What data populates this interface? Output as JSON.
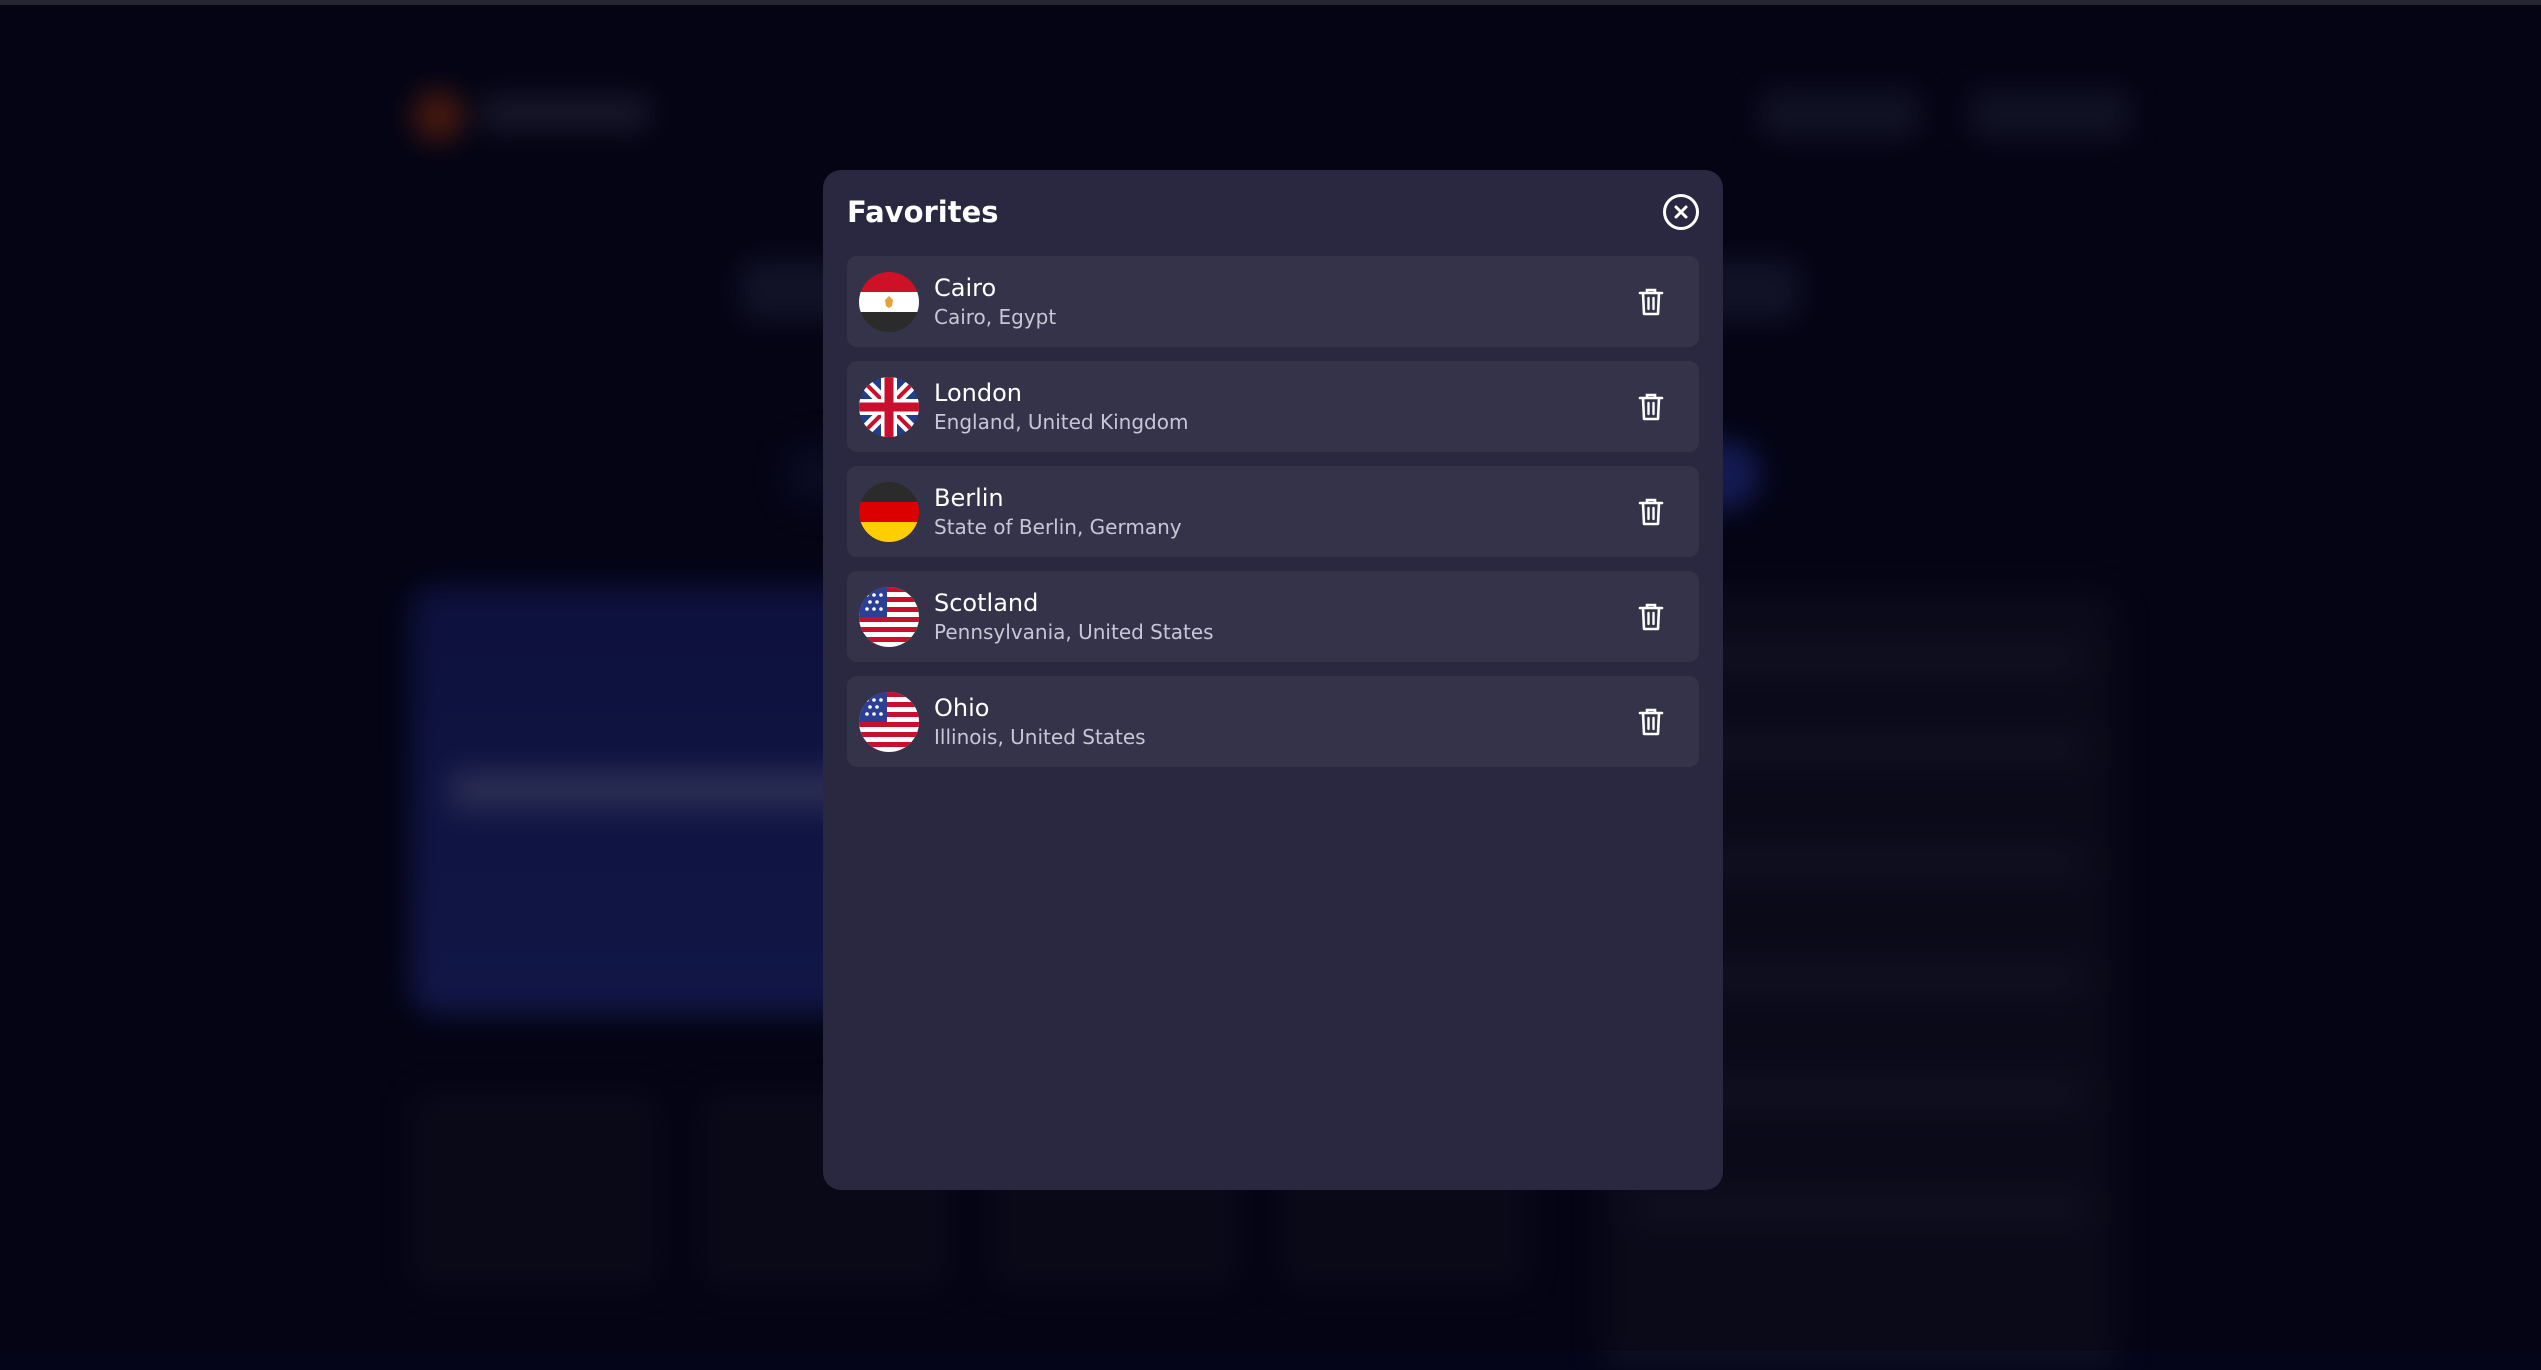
{
  "modal": {
    "title": "Favorites",
    "close_icon": "close-circle-icon"
  },
  "favorites": [
    {
      "city": "Cairo",
      "region": "Cairo, Egypt",
      "flag": "egypt-flag-icon"
    },
    {
      "city": "London",
      "region": "England, United Kingdom",
      "flag": "uk-flag-icon"
    },
    {
      "city": "Berlin",
      "region": "State of Berlin, Germany",
      "flag": "germany-flag-icon"
    },
    {
      "city": "Scotland",
      "region": "Pennsylvania, United States",
      "flag": "usa-flag-icon"
    },
    {
      "city": "Ohio",
      "region": "Illinois, United States",
      "flag": "usa-flag-icon"
    }
  ],
  "colors": {
    "modal_background": "#2a2840",
    "item_background": "#353349",
    "page_background": "#05051a",
    "accent_blue": "#2b3aa5"
  }
}
